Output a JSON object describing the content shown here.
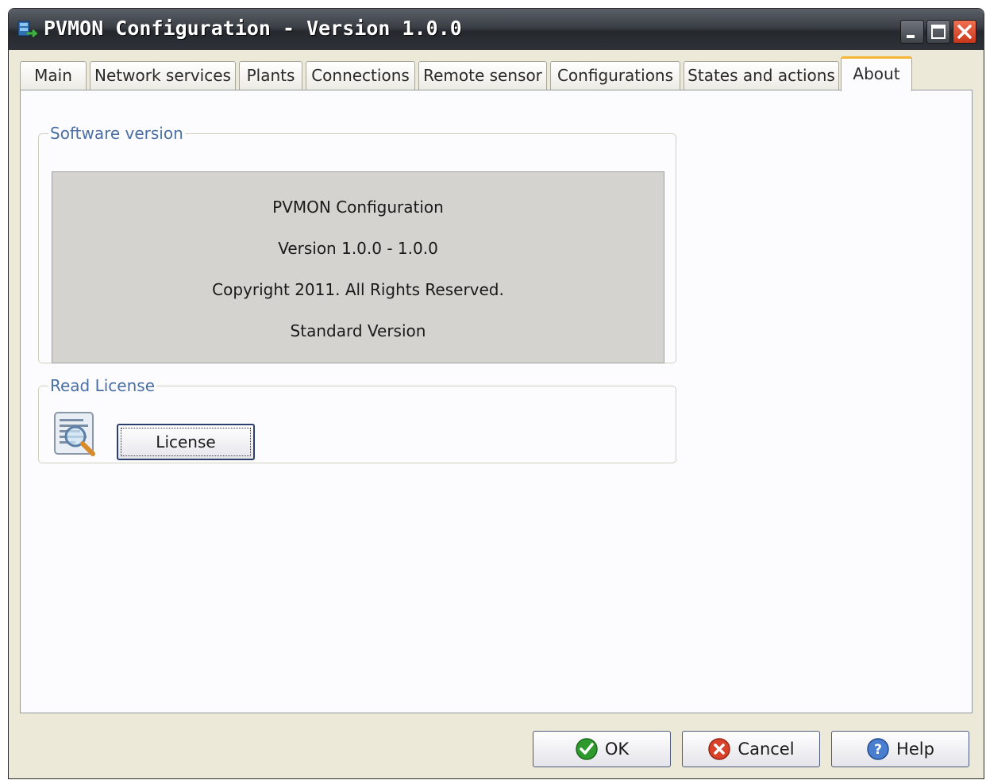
{
  "window": {
    "title": "PVMON Configuration - Version 1.0.0"
  },
  "tabs": [
    {
      "label": "Main"
    },
    {
      "label": "Network services"
    },
    {
      "label": "Plants"
    },
    {
      "label": "Connections"
    },
    {
      "label": "Remote sensor"
    },
    {
      "label": "Configurations"
    },
    {
      "label": "States and actions"
    },
    {
      "label": "About",
      "active": true
    }
  ],
  "software_version": {
    "legend": "Software version",
    "lines": [
      "PVMON Configuration",
      "Version 1.0.0 - 1.0.0",
      "Copyright 2011. All Rights Reserved.",
      "Standard Version"
    ]
  },
  "read_license": {
    "legend": "Read License",
    "button_label": "License",
    "icon": "document-magnifier-icon"
  },
  "footer": {
    "ok_label": "OK",
    "cancel_label": "Cancel",
    "help_label": "Help"
  },
  "colors": {
    "active_tab_accent": "#f7b535",
    "group_legend": "#4a6fa3",
    "title_bar": "#3a3e45"
  }
}
